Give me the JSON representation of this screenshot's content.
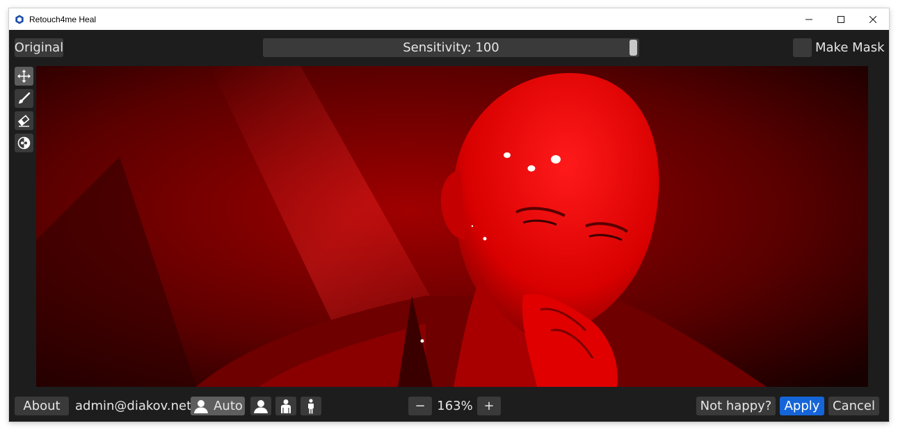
{
  "window": {
    "title": "Retouch4me Heal",
    "app_icon": "hexagon-logo-icon",
    "controls": [
      "minimize-icon",
      "maximize-icon",
      "close-icon"
    ]
  },
  "topbar": {
    "original_label": "Original",
    "sensitivity_label": "Sensitivity: 100",
    "sensitivity_value": 100,
    "make_mask_label": "Make Mask",
    "make_mask_checked": false
  },
  "tools": [
    {
      "name": "move-icon",
      "active": true
    },
    {
      "name": "brush-icon",
      "active": false
    },
    {
      "name": "eraser-icon",
      "active": false
    },
    {
      "name": "heal-reset-icon",
      "active": false
    }
  ],
  "bottombar": {
    "about_label": "About",
    "user_email": "admin@diakov.net",
    "auto_label": "Auto",
    "modes": [
      "face-mode-icon",
      "torso-mode-icon",
      "full-body-mode-icon"
    ],
    "zoom_minus": "−",
    "zoom_value": "163%",
    "zoom_plus": "+",
    "not_happy_label": "Not happy?",
    "apply_label": "Apply",
    "cancel_label": "Cancel"
  },
  "colors": {
    "background": "#1d1d1d",
    "button": "#3a3a3a",
    "button_active": "#5e5e5e",
    "accent": "#1565d8",
    "mask_overlay": "#ff0000"
  }
}
